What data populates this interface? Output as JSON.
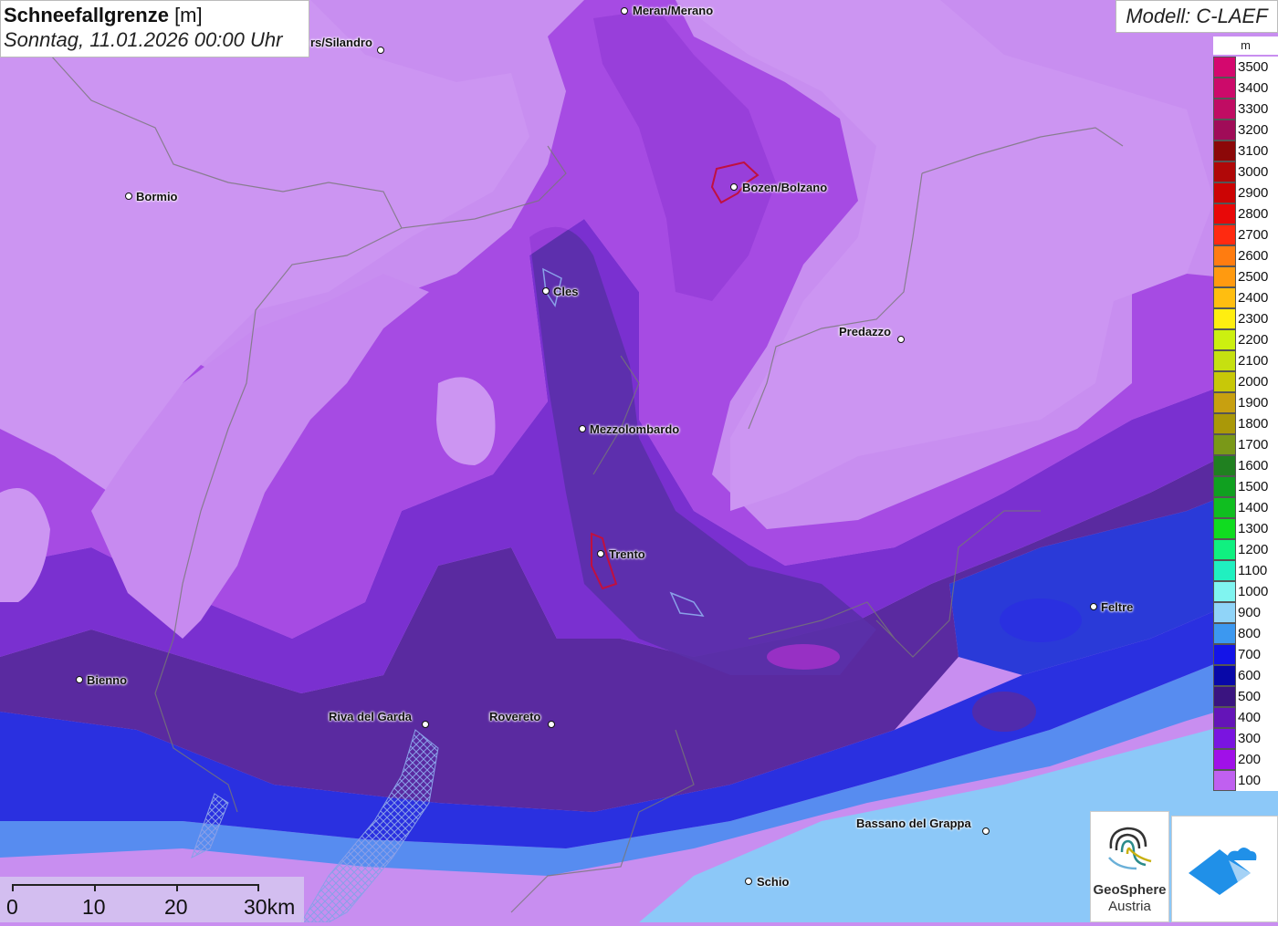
{
  "title": {
    "main": "Schneefallgrenze",
    "unit": " [m]",
    "subtitle": "Sonntag, 11.01.2026 00:00 Uhr"
  },
  "model": "Modell: C-LAEF",
  "legend": {
    "unit": "m",
    "entries": [
      {
        "label": "3500",
        "color": "#d4086e"
      },
      {
        "label": "3400",
        "color": "#cc0a6a"
      },
      {
        "label": "3300",
        "color": "#c00c63"
      },
      {
        "label": "3200",
        "color": "#a00c58"
      },
      {
        "label": "3100",
        "color": "#8c0808"
      },
      {
        "label": "3000",
        "color": "#b00808"
      },
      {
        "label": "2900",
        "color": "#cc0404"
      },
      {
        "label": "2800",
        "color": "#e80808"
      },
      {
        "label": "2700",
        "color": "#ff2a10"
      },
      {
        "label": "2600",
        "color": "#ff7c10"
      },
      {
        "label": "2500",
        "color": "#ff9a10"
      },
      {
        "label": "2400",
        "color": "#ffbe10"
      },
      {
        "label": "2300",
        "color": "#ffee10"
      },
      {
        "label": "2200",
        "color": "#ccf010"
      },
      {
        "label": "2100",
        "color": "#c6e010"
      },
      {
        "label": "2000",
        "color": "#c8c808"
      },
      {
        "label": "1900",
        "color": "#c8a010"
      },
      {
        "label": "1800",
        "color": "#aa9808"
      },
      {
        "label": "1700",
        "color": "#7a9818"
      },
      {
        "label": "1600",
        "color": "#208020"
      },
      {
        "label": "1500",
        "color": "#10a020"
      },
      {
        "label": "1400",
        "color": "#10be20"
      },
      {
        "label": "1300",
        "color": "#10dc20"
      },
      {
        "label": "1200",
        "color": "#10f080"
      },
      {
        "label": "1100",
        "color": "#20f0c0"
      },
      {
        "label": "1000",
        "color": "#80f4f0"
      },
      {
        "label": "900",
        "color": "#90d4f8"
      },
      {
        "label": "800",
        "color": "#3c98f0"
      },
      {
        "label": "700",
        "color": "#1414e8"
      },
      {
        "label": "600",
        "color": "#0808a8"
      },
      {
        "label": "500",
        "color": "#3a1480"
      },
      {
        "label": "400",
        "color": "#6414b8"
      },
      {
        "label": "300",
        "color": "#7a14e0"
      },
      {
        "label": "200",
        "color": "#a010e8"
      },
      {
        "label": "100",
        "color": "#c060f0"
      }
    ]
  },
  "cities": [
    {
      "name": "Meran/Merano",
      "id": "meran"
    },
    {
      "name": "rs/Silandro",
      "id": "silandro"
    },
    {
      "name": "Bormio",
      "id": "bormio"
    },
    {
      "name": "Bozen/Bolzano",
      "id": "bozen"
    },
    {
      "name": "Cles",
      "id": "cles"
    },
    {
      "name": "Predazzo",
      "id": "predazzo"
    },
    {
      "name": "Mezzolombardo",
      "id": "mezzolombardo"
    },
    {
      "name": "Trento",
      "id": "trento"
    },
    {
      "name": "Feltre",
      "id": "feltre"
    },
    {
      "name": "Bienno",
      "id": "bienno"
    },
    {
      "name": "Riva del Garda",
      "id": "riva"
    },
    {
      "name": "Rovereto",
      "id": "rovereto"
    },
    {
      "name": "Bassano del Grappa",
      "id": "bassano"
    },
    {
      "name": "Schio",
      "id": "schio"
    }
  ],
  "scale": {
    "labels": [
      "0",
      "10",
      "20",
      "30km"
    ]
  },
  "logos": {
    "geosphere_line1": "GeoSphere",
    "geosphere_line2": "Austria"
  }
}
